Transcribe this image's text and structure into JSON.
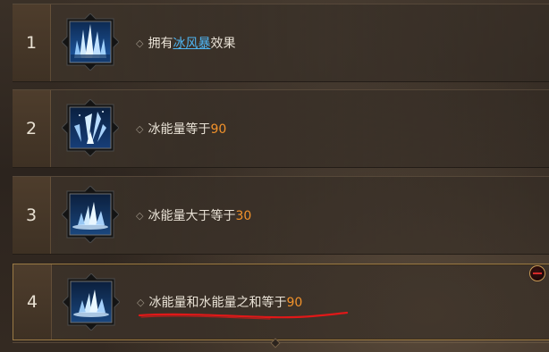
{
  "conditions": [
    {
      "index": "1",
      "icon": "ice-storm-crystal-icon",
      "text_before": "拥有",
      "link_text": "冰风暴",
      "text_after": "效果"
    },
    {
      "index": "2",
      "icon": "ice-shard-crystal-icon",
      "text": "冰能量等于",
      "value": "90"
    },
    {
      "index": "3",
      "icon": "ice-burst-crystal-icon",
      "text": "冰能量大于等于",
      "value": "30"
    },
    {
      "index": "4",
      "icon": "ice-burst-crystal-icon",
      "text": "冰能量和水能量之和等于",
      "value": "90"
    }
  ],
  "colors": {
    "link": "#4fb5f2",
    "value": "#f2922b",
    "selected_border": "#9a7a45",
    "annotation_underline": "#e01818"
  }
}
